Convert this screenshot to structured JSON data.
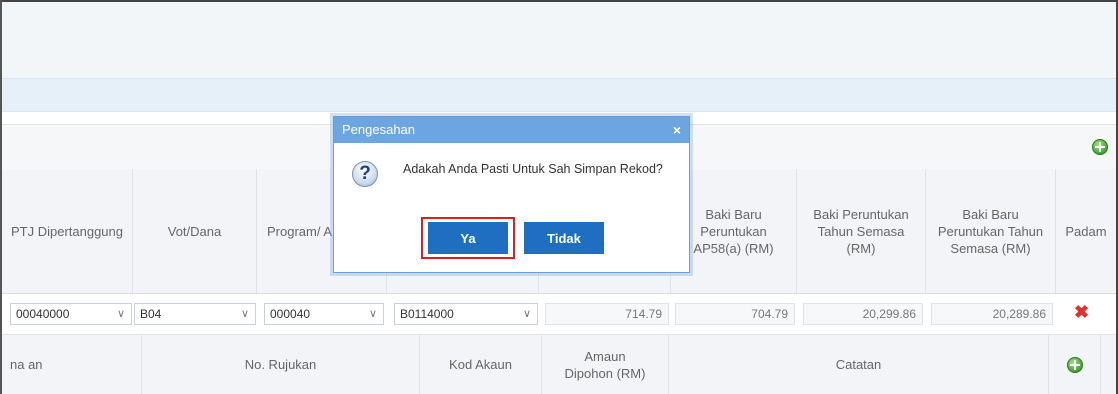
{
  "table": {
    "headers": {
      "ptj": "PTJ Dipertanggung",
      "vot": "Vot/Dana",
      "program": "Program/ A",
      "baki_ap58": "Baki Baru Peruntukan AP58(a) (RM)",
      "baki_semasa": "Baki Peruntukan Tahun Semasa (RM)",
      "baki_baru_semasa": "Baki Baru Peruntukan Tahun Semasa (RM)",
      "padam": "Padam"
    },
    "row": {
      "ptj": "00040000",
      "vot": "B04",
      "program": "000040",
      "akaun": "B0114000",
      "amaun": "714.79",
      "baki_ap58": "704.79",
      "baki_semasa": "20,299.86",
      "baki_baru_semasa": "20,289.86"
    },
    "sub_headers": {
      "nama": "na an",
      "no_rujukan": "No. Rujukan",
      "kod_akaun": "Kod Akaun",
      "amaun": "Amaun Dipohon (RM)",
      "catatan": "Catatan"
    }
  },
  "dialog": {
    "title": "Pengesahan",
    "message": "Adakah Anda Pasti Untuk Sah Simpan Rekod?",
    "yes_label": "Ya",
    "no_label": "Tidak",
    "close_glyph": "×"
  },
  "icons": {
    "question": "question-icon",
    "add": "add-icon",
    "delete": "delete-icon",
    "chevron": "chevron-down-icon"
  },
  "colors": {
    "dialog_title_bg": "#6ca5e2",
    "button_bg": "#1e6fc2",
    "focus_outline": "#e31b23",
    "delete_red": "#e0322a",
    "add_green": "#3e9c2c"
  }
}
